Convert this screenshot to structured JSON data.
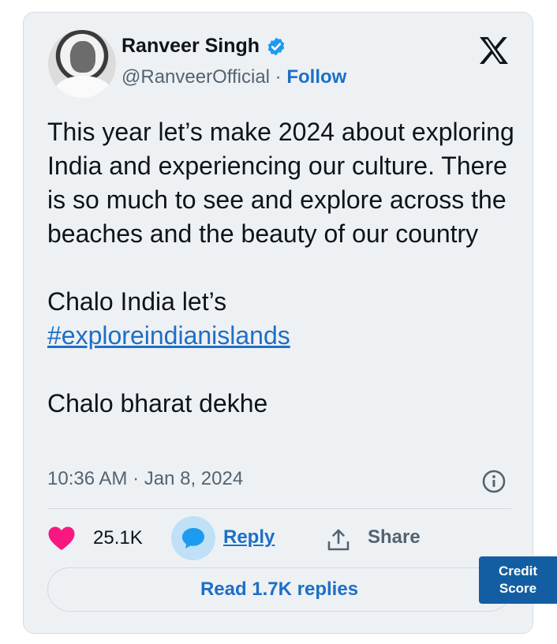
{
  "tweet": {
    "author": {
      "name": "Ranveer Singh",
      "handle": "@RanveerOfficial",
      "separator": "·",
      "follow_label": "Follow",
      "verified_badge_color": "#1d9bf0"
    },
    "platform_icon": "x-logo-icon",
    "body": {
      "paragraph1": "This year let’s make 2024 about exploring India and experiencing our culture. There is so much to see and explore across the beaches and the beauty of our country",
      "line_chalo": "Chalo India let’s",
      "hashtag": "#exploreindianislands",
      "closing": "Chalo bharat dekhe"
    },
    "timestamp": "10:36 AM · Jan 8, 2024",
    "actions": {
      "like_count": "25.1K",
      "like_icon_color": "#f91880",
      "reply_label": "Reply",
      "share_label": "Share"
    },
    "read_replies_label": "Read 1.7K replies"
  },
  "credit_widget": {
    "line1": "Credit",
    "line2": "Score",
    "color": "#135ea3"
  },
  "colors": {
    "link": "#1d6fc5",
    "muted_text": "#536471",
    "card_background": "#eef1f4"
  }
}
